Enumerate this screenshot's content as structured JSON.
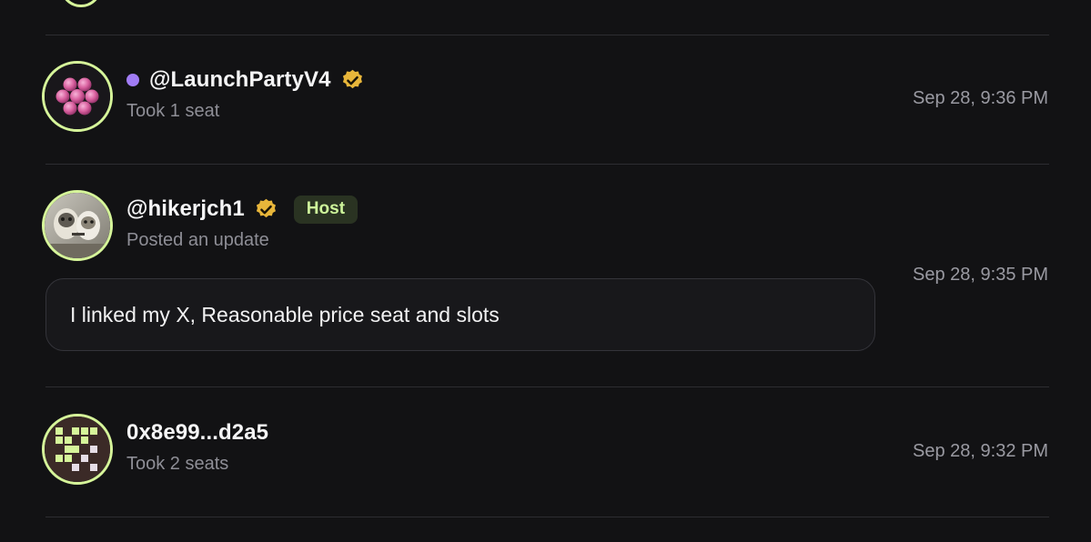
{
  "activity": [
    {
      "username": "@LaunchPartyV4",
      "status_icon": "online-dot-icon",
      "verified": true,
      "action": "Took 1 seat",
      "time": "Sep 28, 9:36 PM",
      "avatar": "pink-dots-avatar"
    },
    {
      "username": "@hikerjch1",
      "verified": true,
      "badge": "Host",
      "action": "Posted an update",
      "message": "I linked my X, Reasonable price seat and slots",
      "time": "Sep 28, 9:35 PM",
      "avatar": "photo-avatar"
    },
    {
      "username": "0x8e99...d2a5",
      "verified": false,
      "action": "Took 2 seats",
      "time": "Sep 28, 9:32 PM",
      "avatar": "pixel-pattern-avatar"
    }
  ],
  "colors": {
    "background": "#121214",
    "avatar_ring": "#d6f59a",
    "status_dot": "#a17cf5",
    "verified_badge": "#e8b63a",
    "host_badge_bg": "#2a3322",
    "host_badge_text": "#cdf49a",
    "muted_text": "#8e8e96",
    "divider": "#2d2d31"
  }
}
